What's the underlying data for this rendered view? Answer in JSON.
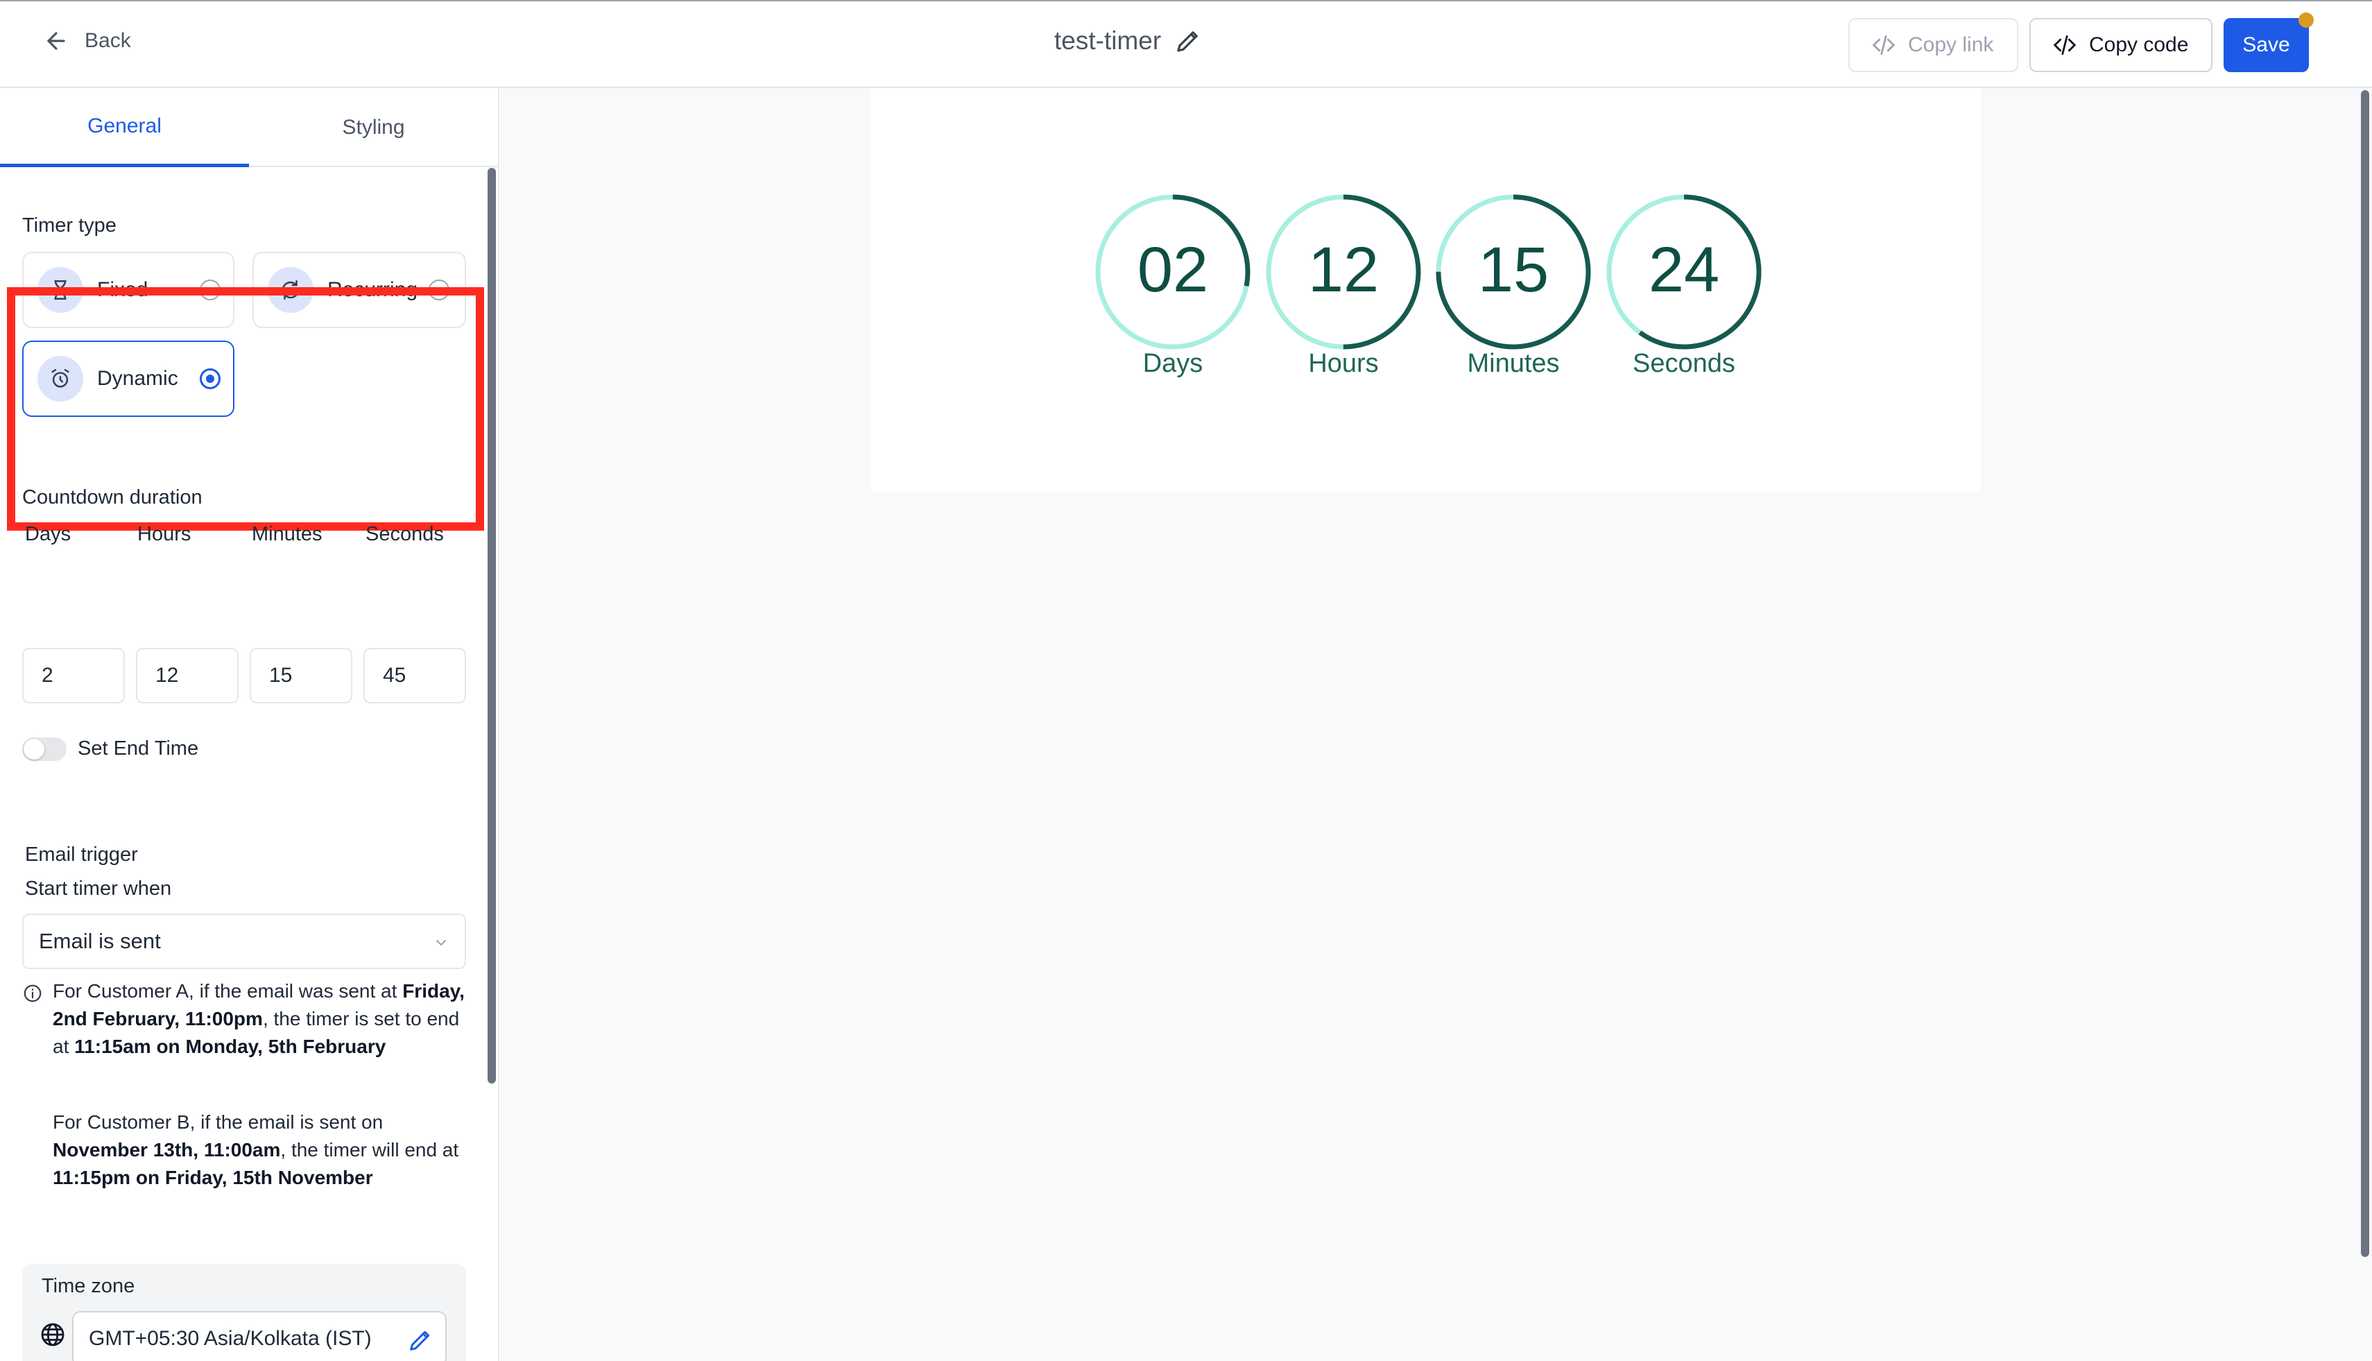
{
  "header": {
    "back_label": "Back",
    "title": "test-timer",
    "copy_link_label": "Copy link",
    "copy_code_label": "Copy code",
    "save_label": "Save"
  },
  "tabs": [
    {
      "label": "General",
      "active": true
    },
    {
      "label": "Styling",
      "active": false
    }
  ],
  "timer_type": {
    "label": "Timer type",
    "options": [
      {
        "label": "Fixed",
        "icon": "hourglass-icon",
        "selected": false
      },
      {
        "label": "Recurring",
        "icon": "refresh-icon",
        "selected": false
      },
      {
        "label": "Dynamic",
        "icon": "alarm-clock-icon",
        "selected": true
      }
    ]
  },
  "countdown": {
    "label": "Countdown duration",
    "fields": [
      {
        "label": "Days",
        "value": "2"
      },
      {
        "label": "Hours",
        "value": "12"
      },
      {
        "label": "Minutes",
        "value": "15"
      },
      {
        "label": "Seconds",
        "value": "45"
      }
    ],
    "end_time_toggle_label": "Set End Time",
    "end_time_enabled": false
  },
  "email_trigger": {
    "label": "Email trigger",
    "start_label": "Start timer when",
    "selected": "Email is sent",
    "example_a": {
      "t1": "For Customer A, if the email was sent at ",
      "b1": "Friday, 2nd February, 11:00pm",
      "t2": ", the timer is set to end at ",
      "b2": "11:15am on Monday, 5th February"
    },
    "example_b": {
      "t1": "For Customer B, if the email is sent on ",
      "b1": "November 13th, 11:00am",
      "t2": ", the timer will end at ",
      "b2": "11:15pm on Friday, 15th November"
    }
  },
  "timezone": {
    "label": "Time zone",
    "value": "GMT+05:30 Asia/Kolkata (IST)"
  },
  "preview": {
    "units": [
      {
        "value": "02",
        "label": "Days",
        "progress": 0.28
      },
      {
        "value": "12",
        "label": "Hours",
        "progress": 0.5
      },
      {
        "value": "15",
        "label": "Minutes",
        "progress": 0.75
      },
      {
        "value": "24",
        "label": "Seconds",
        "progress": 0.6
      }
    ]
  },
  "colors": {
    "accent": "#1d5be6",
    "highlight": "#ff2a1f",
    "ring_track": "#a7efe0",
    "ring_fill": "#17594e",
    "notification_dot": "#d99a1f"
  }
}
